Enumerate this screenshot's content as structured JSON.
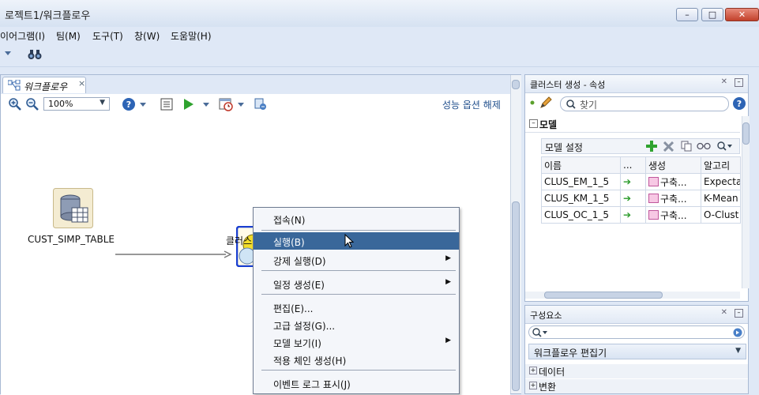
{
  "window": {
    "title": "로젝트1/워크플로우",
    "minimize_glyph": "–",
    "maximize_glyph": "□",
    "close_glyph": "✕"
  },
  "menu": [
    "이어그램(I)",
    "팀(M)",
    "도구(T)",
    "창(W)",
    "도움말(H)"
  ],
  "tab": {
    "label": "워크플로우",
    "close_glyph": "×"
  },
  "toolbar": {
    "zoom_value": "100%",
    "performance_link": "성능 옵션 해제"
  },
  "canvas": {
    "node_source_label": "CUST_SIMP_TABLE",
    "node_cluster_label": "클러스"
  },
  "context_menu": {
    "items": [
      {
        "label": "접속(N)"
      },
      {
        "label": "실행(B)"
      },
      {
        "label": "강제 실행(D)"
      },
      {
        "label": "일정 생성(E)"
      },
      {
        "label": "편집(E)..."
      },
      {
        "label": "고급 설정(G)..."
      },
      {
        "label": "모델 보기(I)"
      },
      {
        "label": "적용 체인 생성(H)"
      },
      {
        "label": "이벤트 로그 표시(J)"
      }
    ]
  },
  "props_panel": {
    "title": "클러스터 생성 - 속성",
    "search_placeholder": "찾기",
    "section_title": "모델",
    "model_settings_label": "모델 설정",
    "columns": [
      "이름",
      "...",
      "생성",
      "알고리"
    ],
    "rows": [
      {
        "name": "CLUS_EM_1_5",
        "build": "구축...",
        "algorithm": "Expecta"
      },
      {
        "name": "CLUS_KM_1_5",
        "build": "구축...",
        "algorithm": "K-Mean"
      },
      {
        "name": "CLUS_OC_1_5",
        "build": "구축...",
        "algorithm": "O-Clust"
      }
    ]
  },
  "components_panel": {
    "title": "구성요소",
    "dropdown_value": "워크플로우 편집기",
    "categories": [
      "데이터",
      "변환"
    ]
  },
  "colors": {
    "selection": "#39679a",
    "accent_link": "#1f4e8c",
    "node_border": "#1a3fd0"
  }
}
